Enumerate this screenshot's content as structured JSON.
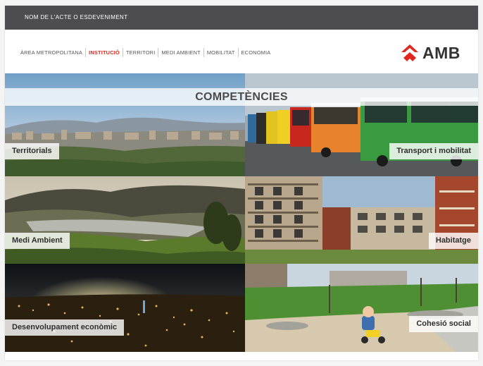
{
  "header": {
    "event_name": "NOM DE L'ACTE O ESDEVENIMENT"
  },
  "nav": {
    "items": [
      {
        "label": "ÀREA METROPOLITANA",
        "active": false
      },
      {
        "label": "INSTITUCIÓ",
        "active": true
      },
      {
        "label": "TERRITORI",
        "active": false
      },
      {
        "label": "MEDI AMBIENT",
        "active": false
      },
      {
        "label": "MOBILITAT",
        "active": false
      },
      {
        "label": "ECONOMIA",
        "active": false
      }
    ]
  },
  "logo": {
    "text": "AMB",
    "icon": "amb-chevron-logo",
    "color": "#e1261c"
  },
  "main": {
    "title": "COMPETÈNCIES",
    "tiles": [
      {
        "label": "Territorials"
      },
      {
        "label": "Transport i mobilitat"
      },
      {
        "label": "Medi Ambient"
      },
      {
        "label": "Habitatge"
      },
      {
        "label": "Desenvolupament econòmic"
      },
      {
        "label": "Cohesió social"
      }
    ]
  },
  "colors": {
    "accent": "#e1261c",
    "topbar": "#4d4d4f",
    "nav_text": "#555555"
  }
}
